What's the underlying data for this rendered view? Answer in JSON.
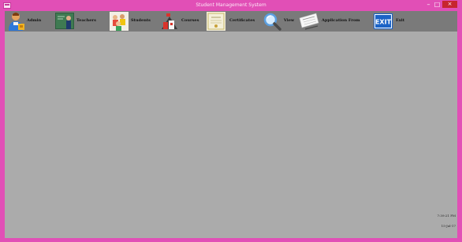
{
  "window": {
    "title": "Student Management System",
    "controls": {
      "minimize": "–",
      "maximize": "□",
      "close": "×"
    }
  },
  "menu": {
    "items": [
      {
        "label": "Admin",
        "icon": "admin-user-icon"
      },
      {
        "label": "Teachers",
        "icon": "teacher-blackboard-icon"
      },
      {
        "label": "Students",
        "icon": "students-group-icon"
      },
      {
        "label": "Courses",
        "icon": "courses-books-icon"
      },
      {
        "label": "Certificates",
        "icon": "certificate-icon"
      },
      {
        "label": "View",
        "icon": "magnifier-icon"
      },
      {
        "label": "Application From",
        "icon": "application-form-icon"
      },
      {
        "label": "Exit",
        "icon": "exit-sign-icon"
      }
    ]
  },
  "status": {
    "time": "7:39:21 PM",
    "date": "15-Jul-17"
  },
  "colors": {
    "titlebar": "#e14fb6",
    "menubar": "#7a7a7a",
    "workspace": "#ababab",
    "close_button": "#c7252d",
    "exit_blue": "#1b63c6"
  }
}
